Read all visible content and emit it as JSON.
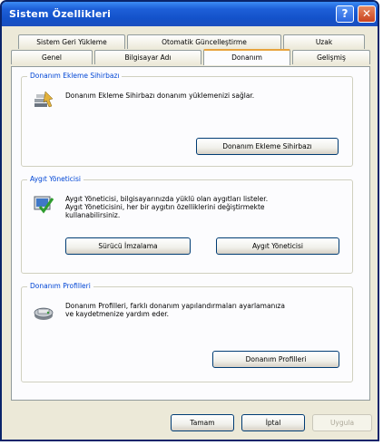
{
  "window": {
    "title": "Sistem Özellikleri"
  },
  "title_buttons": {
    "help": "?",
    "close": "✕"
  },
  "tabs": {
    "row1": [
      {
        "label": "Sistem Geri Yükleme"
      },
      {
        "label": "Otomatik Güncelleştirme"
      },
      {
        "label": "Uzak"
      }
    ],
    "row2": [
      {
        "label": "Genel"
      },
      {
        "label": "Bilgisayar Adı"
      },
      {
        "label": "Donanım",
        "active": true
      },
      {
        "label": "Gelişmiş"
      }
    ]
  },
  "groups": {
    "hardware_wizard": {
      "label": "Donanım Ekleme Sihirbazı",
      "description": "Donanım Ekleme Sihirbazı donanım yüklemenizi sağlar.",
      "button": "Donanım Ekleme Sihirbazı",
      "icon": "hardware-wizard-icon"
    },
    "device_manager": {
      "label": "Aygıt Yöneticisi",
      "description_lines": [
        "Aygıt Yöneticisi, bilgisayarınızda yüklü olan aygıtları listeler.",
        "Aygıt Yöneticisini, her bir aygıtın özelliklerini değiştirmekte",
        "kullanabilirsiniz."
      ],
      "buttons": [
        "Sürücü İmzalama",
        "Aygıt Yöneticisi"
      ],
      "icon": "device-manager-icon"
    },
    "hardware_profiles": {
      "label": "Donanım Profilleri",
      "description_lines": [
        "Donanım Profilleri, farklı donanım yapılandırmaları ayarlamanıza",
        "ve kaydetmenize yardım eder."
      ],
      "button": "Donanım Profilleri",
      "icon": "hardware-profiles-icon"
    }
  },
  "dialog_buttons": {
    "ok": "Tamam",
    "cancel": "İptal",
    "apply": "Uygula"
  },
  "colors": {
    "titlebar": "#1d5fd8",
    "group_label": "#0046d5",
    "active_tab_accent": "#e8a33d"
  }
}
